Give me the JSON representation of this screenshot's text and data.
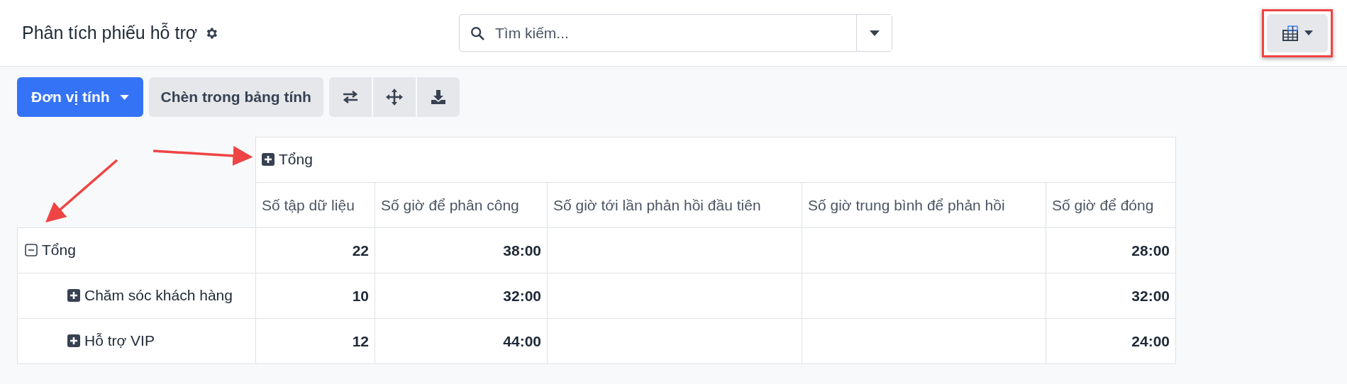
{
  "header": {
    "title": "Phân tích phiếu hỗ trợ",
    "search": {
      "placeholder": "Tìm kiếm..."
    },
    "view_switcher": {
      "highlighted": true
    }
  },
  "toolbar": {
    "measures_button": "Đơn vị tính",
    "insert_button": "Chèn trong bảng tính"
  },
  "pivot": {
    "column_group": {
      "label": "Tổng",
      "expanded": false
    },
    "columns": [
      "Số tập dữ liệu",
      "Số giờ để phân công",
      "Số giờ tới lần phản hồi đầu tiên",
      "Số giờ trung bình để phản hồi",
      "Số giờ để đóng"
    ],
    "rows": [
      {
        "label": "Tổng",
        "expanded": true,
        "cells": [
          {
            "kind": "value",
            "value": "22"
          },
          {
            "kind": "value",
            "value": "38:00"
          },
          {
            "kind": "empty"
          },
          {
            "kind": "empty"
          },
          {
            "kind": "value",
            "value": "28:00"
          }
        ],
        "children": [
          {
            "label": "Chăm sóc khách hàng",
            "expanded": false,
            "cells": [
              {
                "kind": "value",
                "value": "10"
              },
              {
                "kind": "value",
                "value": "32:00"
              },
              {
                "kind": "empty"
              },
              {
                "kind": "empty"
              },
              {
                "kind": "value",
                "value": "32:00"
              }
            ]
          },
          {
            "label": "Hỗ trợ VIP",
            "expanded": false,
            "cells": [
              {
                "kind": "value",
                "value": "12"
              },
              {
                "kind": "value",
                "value": "44:00"
              },
              {
                "kind": "empty"
              },
              {
                "kind": "empty"
              },
              {
                "kind": "value",
                "value": "24:00"
              }
            ]
          }
        ]
      }
    ]
  }
}
